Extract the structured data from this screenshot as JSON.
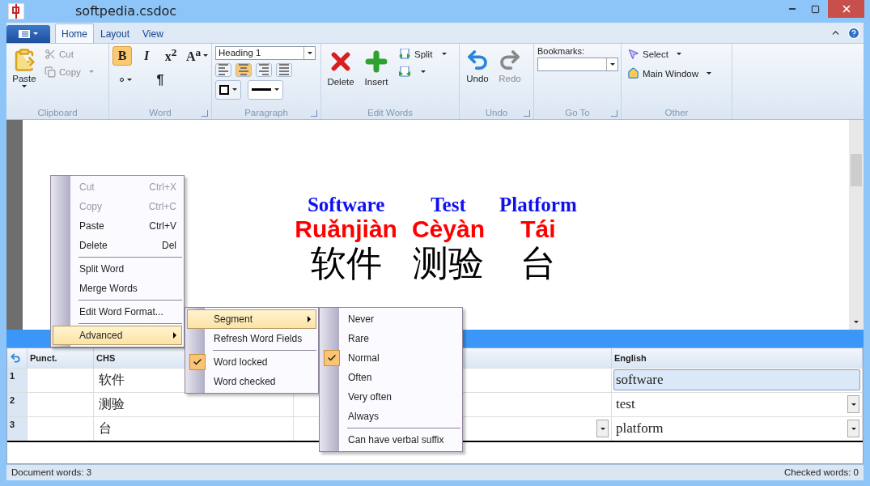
{
  "window": {
    "title": "softpedia.csdoc"
  },
  "ribbon_tabs": [
    {
      "label": "Home",
      "selected": true
    },
    {
      "label": "Layout",
      "selected": false
    },
    {
      "label": "View",
      "selected": false
    }
  ],
  "clipboard": {
    "label": "Clipboard",
    "paste": "Paste",
    "cut": {
      "label": "Cut",
      "disabled": true
    },
    "copy": {
      "label": "Copy",
      "disabled": true
    }
  },
  "word_group": {
    "label": "Word",
    "bold": {
      "label": "B",
      "selected": true
    },
    "italic": {
      "label": "I",
      "selected": false
    },
    "superscript": "x$^{2}$",
    "font_size": "A$^{a}$",
    "paragraph_mark": "¶"
  },
  "paragraph": {
    "label": "Paragraph",
    "style": "Heading 1",
    "alignments": [
      {
        "kind": "left",
        "selected": false
      },
      {
        "kind": "center",
        "selected": true
      },
      {
        "kind": "right",
        "selected": false
      },
      {
        "kind": "justify",
        "selected": false
      }
    ]
  },
  "edit_words": {
    "label": "Edit Words",
    "delete": "Delete",
    "insert": "Insert",
    "split": "Split"
  },
  "undo_group": {
    "label": "Undo",
    "undo": {
      "label": "Undo",
      "disabled": false
    },
    "redo": {
      "label": "Redo",
      "disabled": true
    }
  },
  "goto": {
    "label": "Go To",
    "bookmarks_label": "Bookmarks:"
  },
  "other": {
    "label": "Other",
    "select": "Select",
    "main_window": "Main Window"
  },
  "document_words": [
    {
      "english": "Software",
      "pinyin": "Ruǎnjiàn",
      "hanzi": "软件"
    },
    {
      "english": "Test",
      "pinyin": "Cèyàn",
      "hanzi": "测验"
    },
    {
      "english": "Platform",
      "pinyin": "Tái",
      "hanzi": "台"
    }
  ],
  "context_menu": [
    {
      "kind": "item",
      "label": "Cut",
      "shortcut": "Ctrl+X",
      "disabled": true,
      "selected": false,
      "submenu": false
    },
    {
      "kind": "item",
      "label": "Copy",
      "shortcut": "Ctrl+C",
      "disabled": true,
      "selected": false,
      "submenu": false
    },
    {
      "kind": "item",
      "label": "Paste",
      "shortcut": "Ctrl+V",
      "disabled": false,
      "selected": false,
      "submenu": false
    },
    {
      "kind": "item",
      "label": "Delete",
      "shortcut": "Del",
      "disabled": false,
      "selected": false,
      "submenu": false
    },
    {
      "kind": "separator"
    },
    {
      "kind": "item",
      "label": "Split Word",
      "disabled": false,
      "selected": false,
      "submenu": false
    },
    {
      "kind": "item",
      "label": "Merge Words",
      "disabled": false,
      "selected": false,
      "submenu": false
    },
    {
      "kind": "separator"
    },
    {
      "kind": "item",
      "label": "Edit Word Format...",
      "disabled": false,
      "selected": false,
      "submenu": false
    },
    {
      "kind": "separator"
    },
    {
      "kind": "item",
      "label": "Advanced",
      "disabled": false,
      "selected": true,
      "submenu": true
    }
  ],
  "advanced_menu": [
    {
      "kind": "item",
      "label": "Segment",
      "selected": true,
      "submenu": true,
      "checked": false
    },
    {
      "kind": "item",
      "label": "Refresh Word Fields",
      "selected": false,
      "submenu": false,
      "checked": false
    },
    {
      "kind": "separator"
    },
    {
      "kind": "item",
      "label": "Word locked",
      "selected": false,
      "submenu": false,
      "checked": true
    },
    {
      "kind": "item",
      "label": "Word checked",
      "selected": false,
      "submenu": false,
      "checked": false
    }
  ],
  "segment_menu": [
    {
      "kind": "item",
      "label": "Never",
      "checked": false
    },
    {
      "kind": "item",
      "label": "Rare",
      "checked": false
    },
    {
      "kind": "item",
      "label": "Normal",
      "checked": true
    },
    {
      "kind": "item",
      "label": "Often",
      "checked": false
    },
    {
      "kind": "item",
      "label": "Very often",
      "checked": false
    },
    {
      "kind": "item",
      "label": "Always",
      "checked": false
    },
    {
      "kind": "separator"
    },
    {
      "kind": "item",
      "label": "Can have verbal suffix",
      "checked": false
    }
  ],
  "table": {
    "columns": [
      "Punct.",
      "CHS",
      "English"
    ],
    "rows": [
      {
        "number": "1",
        "chs": "软件",
        "english": "software",
        "selected": true,
        "middle_dropdown": false
      },
      {
        "number": "2",
        "chs": "测验",
        "english": "test",
        "selected": false,
        "middle_dropdown": false
      },
      {
        "number": "3",
        "chs": "台",
        "english": "platform",
        "selected": false,
        "middle_dropdown": true
      }
    ]
  },
  "status_bar": {
    "left": "Document words: 3",
    "right": "Checked words: 0"
  }
}
